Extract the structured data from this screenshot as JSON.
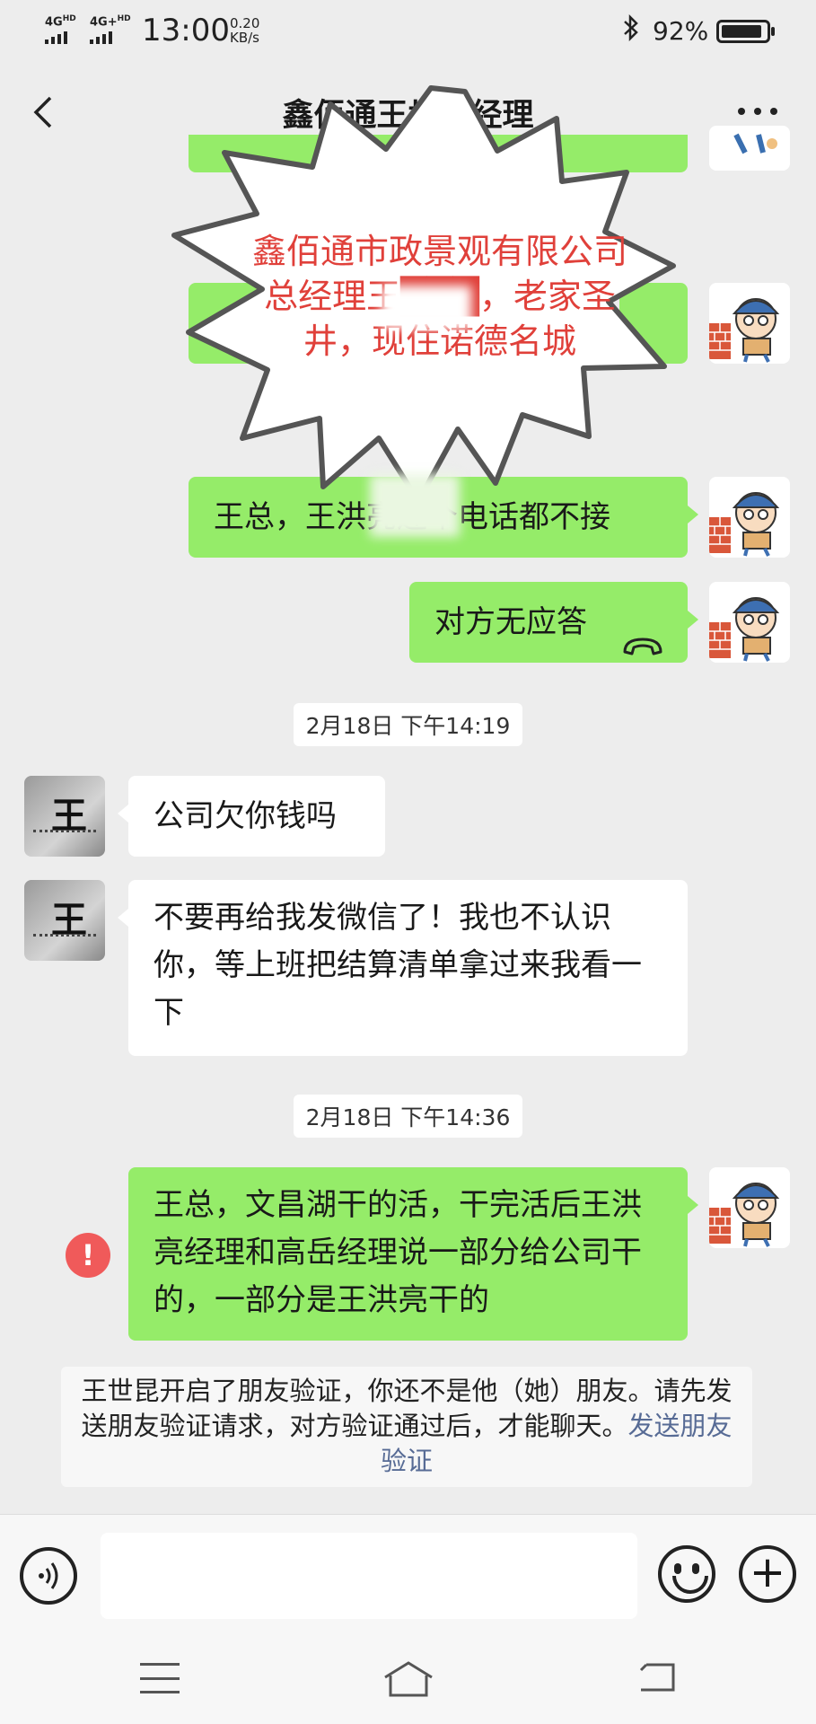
{
  "status_bar": {
    "signal1": "4G",
    "signal1_sup": "HD",
    "signal2": "4G+",
    "signal2_sup": "HD",
    "time": "13:00",
    "speed_value": "0.20",
    "speed_unit": "KB/s",
    "battery_pct": "92%",
    "battery_level": 0.92
  },
  "header": {
    "title": "鑫佰通王世昆经理"
  },
  "overlay": {
    "burst_text": "鑫佰通市政景观有限公司总经理王███，老家圣井，现住诺德名城"
  },
  "messages": {
    "m1": "王总，王洪亮连个电话都不接",
    "m2_text": "对方无应答",
    "m2_icon": "hangup-icon",
    "ts1": "2月18日 下午14:19",
    "m3": "公司欠你钱吗",
    "m4": "不要再给我发微信了！我也不认识你，等上班把结算清单拿过来我看一下",
    "ts2": "2月18日 下午14:36",
    "m5": "王总，文昌湖干的活，干完活后王洪亮经理和高岳经理说一部分给公司干的，一部分是王洪亮干的",
    "error_mark": "!"
  },
  "system_note": {
    "text": "王世昆开启了朋友验证，你还不是他（她）朋友。请先发送朋友验证请求，对方验证通过后，才能聊天。",
    "link": "发送朋友验证"
  },
  "avatars": {
    "other_mark": "王"
  },
  "icons": {
    "back": "chevron-left-icon",
    "more": "more-dots-icon",
    "voice": "voice-icon",
    "emoji": "emoji-icon",
    "plus": "plus-icon",
    "bluetooth": "bluetooth-icon"
  },
  "colors": {
    "bubble_green": "#95ec69",
    "bubble_white": "#ffffff",
    "background": "#ededed",
    "link": "#576b95",
    "error_red": "#f05a5a",
    "burst_text": "#e0403a"
  }
}
